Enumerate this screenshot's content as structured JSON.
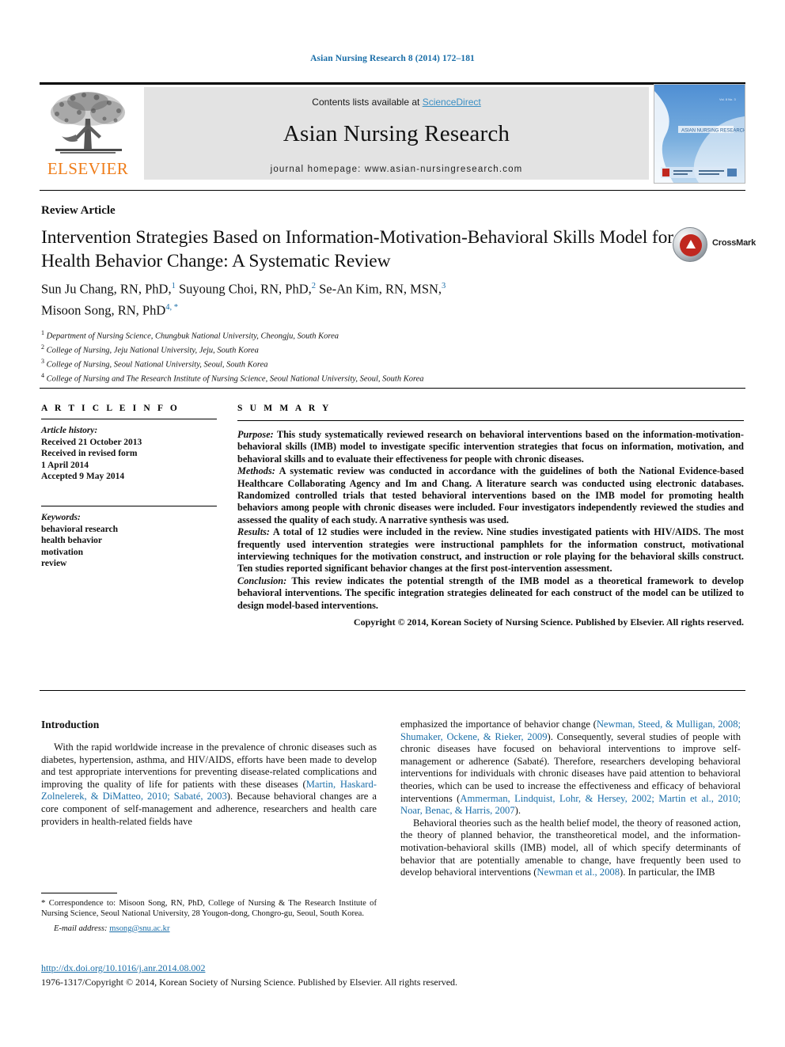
{
  "running_head": "Asian Nursing Research 8 (2014) 172–181",
  "masthead": {
    "contents_prefix": "Contents lists available at ",
    "sciencedirect": "ScienceDirect",
    "journal_title": "Asian Nursing Research",
    "homepage": "journal homepage: www.asian-nursingresearch.com",
    "publisher_logo_text": "ELSEVIER",
    "cover_title": "ASIAN NURSING RESEARCH"
  },
  "article": {
    "type": "Review Article",
    "title": "Intervention Strategies Based on Information-Motivation-Behavioral Skills Model for Health Behavior Change: A Systematic Review",
    "crossmark_label": "CrossMark",
    "authors_line1": "Sun Ju Chang, RN, PhD,",
    "authors_line1_sup1": "1",
    "authors_line1_b": "Suyoung Choi, RN, PhD,",
    "authors_line1_sup2": "2",
    "authors_line1_c": "Se-An Kim, RN, MSN,",
    "authors_line1_sup3": "3",
    "authors_line2": "Misoon Song, RN, PhD",
    "authors_line2_sup": "4, *",
    "affiliations": [
      {
        "num": "1",
        "text": "Department of Nursing Science, Chungbuk National University, Cheongju, South Korea"
      },
      {
        "num": "2",
        "text": "College of Nursing, Jeju National University, Jeju, South Korea"
      },
      {
        "num": "3",
        "text": "College of Nursing, Seoul National University, Seoul, South Korea"
      },
      {
        "num": "4",
        "text": "College of Nursing and The Research Institute of Nursing Science, Seoul National University, Seoul, South Korea"
      }
    ]
  },
  "article_info": {
    "heading": "A R T I C L E  I N F O",
    "history_label": "Article history:",
    "history_lines": [
      "Received 21 October 2013",
      "Received in revised form",
      "1 April 2014",
      "Accepted 9 May 2014"
    ],
    "keywords_label": "Keywords:",
    "keywords": [
      "behavioral research",
      "health behavior",
      "motivation",
      "review"
    ]
  },
  "summary": {
    "heading": "S U M M A R Y",
    "purpose_label": "Purpose:",
    "purpose_text": " This study systematically reviewed research on behavioral interventions based on the information-motivation-behavioral skills (IMB) model to investigate specific intervention strategies that focus on information, motivation, and behavioral skills and to evaluate their effectiveness for people with chronic diseases.",
    "methods_label": "Methods:",
    "methods_text": " A systematic review was conducted in accordance with the guidelines of both the National Evidence-based Healthcare Collaborating Agency and Im and Chang. A literature search was conducted using electronic databases. Randomized controlled trials that tested behavioral interventions based on the IMB model for promoting health behaviors among people with chronic diseases were included. Four investigators independently reviewed the studies and assessed the quality of each study. A narrative synthesis was used.",
    "results_label": "Results:",
    "results_text": " A total of 12 studies were included in the review. Nine studies investigated patients with HIV/AIDS. The most frequently used intervention strategies were instructional pamphlets for the information construct, motivational interviewing techniques for the motivation construct, and instruction or role playing for the behavioral skills construct. Ten studies reported significant behavior changes at the first post-intervention assessment.",
    "conclusion_label": "Conclusion:",
    "conclusion_text": " This review indicates the potential strength of the IMB model as a theoretical framework to develop behavioral interventions. The specific integration strategies delineated for each construct of the model can be utilized to design model-based interventions.",
    "copyright": "Copyright © 2014, Korean Society of Nursing Science. Published by Elsevier. All rights reserved."
  },
  "body": {
    "intro_heading": "Introduction",
    "left_p1_a": "With the rapid worldwide increase in the prevalence of chronic diseases such as diabetes, hypertension, asthma, and HIV/AIDS, efforts have been made to develop and test appropriate interventions for preventing disease-related complications and improving the quality of life for patients with these diseases (",
    "left_p1_ref": "Martin, Haskard-Zolnelerek, & DiMatteo, 2010; Sabaté, 2003",
    "left_p1_b": "). Because behavioral changes are a core component of self-management and adherence, researchers and health care providers in health-related fields have",
    "right_p1_a": "emphasized the importance of behavior change (",
    "right_p1_ref1": "Newman, Steed, & Mulligan, 2008; Shumaker, Ockene, & Rieker, 2009",
    "right_p1_b": "). Consequently, several studies of people with chronic diseases have focused on behavioral interventions to improve self-management or adherence (Sabaté). Therefore, researchers developing behavioral interventions for individuals with chronic diseases have paid attention to behavioral theories, which can be used to increase the effectiveness and efficacy of behavioral interventions (",
    "right_p1_ref2": "Ammerman, Lindquist, Lohr, & Hersey, 2002; Martin et al., 2010; Noar, Benac, & Harris, 2007",
    "right_p1_c": ").",
    "right_p2_a": "Behavioral theories such as the health belief model, the theory of reasoned action, the theory of planned behavior, the transtheoretical model, and the information-motivation-behavioral skills (IMB) model, all of which specify determinants of behavior that are potentially amenable to change, have frequently been used to develop behavioral interventions (",
    "right_p2_ref": "Newman et al., 2008",
    "right_p2_b": "). In particular, the IMB"
  },
  "footnote": {
    "star": "*",
    "text": " Correspondence to: Misoon Song, RN, PhD, College of Nursing & The Research Institute of Nursing Science, Seoul National University, 28 Yougon-dong, Chongro-gu, Seoul, South Korea.",
    "email_label": "E-mail address:",
    "email": "msong@snu.ac.kr"
  },
  "footer": {
    "doi": "http://dx.doi.org/10.1016/j.anr.2014.08.002",
    "issn_copyright": "1976-1317/Copyright © 2014, Korean Society of Nursing Science. Published by Elsevier. All rights reserved."
  },
  "colors": {
    "link_blue": "#1a6ea8",
    "sciencedirect_blue": "#3a8fc4",
    "elsevier_orange": "#ef7d1a",
    "band_gray": "#e3e3e3"
  }
}
